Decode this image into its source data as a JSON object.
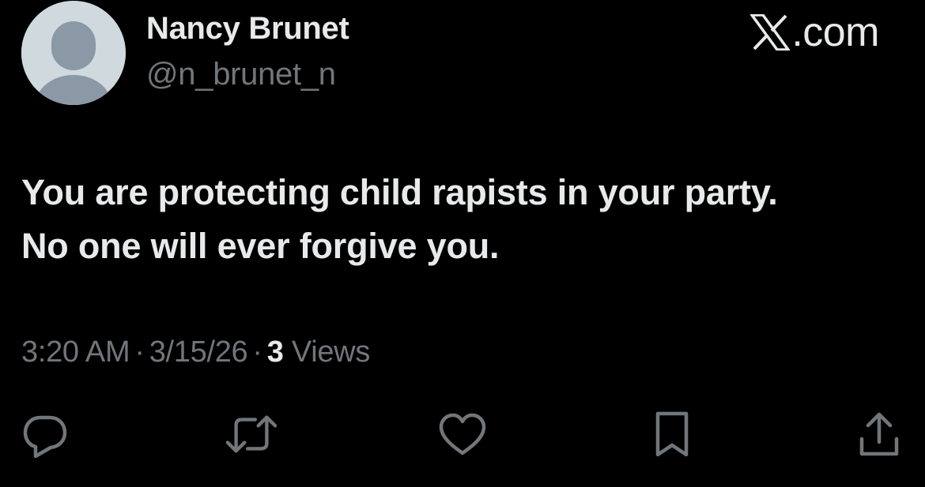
{
  "author": {
    "name": "Nancy Brunet",
    "handle": "@n_brunet_n",
    "avatar_icon": "default-avatar-icon"
  },
  "brand": {
    "icon": "x-logo-icon",
    "domain_suffix": ".com"
  },
  "tweet": {
    "lines": [
      "You are protecting child rapists in your party.",
      "No one will ever forgive you."
    ]
  },
  "meta": {
    "time": "3:20 AM",
    "separator": "·",
    "date": "3/15/26",
    "views_count": "3",
    "views_label": "Views"
  },
  "actions": [
    {
      "name": "reply",
      "icon": "reply-icon"
    },
    {
      "name": "repost",
      "icon": "repost-icon"
    },
    {
      "name": "like",
      "icon": "heart-icon"
    },
    {
      "name": "bookmark",
      "icon": "bookmark-icon"
    },
    {
      "name": "share",
      "icon": "share-icon"
    }
  ],
  "colors": {
    "background": "#000000",
    "primary_text": "#e7e9ea",
    "secondary_text": "#71767b",
    "avatar_bg": "#cfd9de",
    "avatar_figure": "#8b98a5"
  }
}
